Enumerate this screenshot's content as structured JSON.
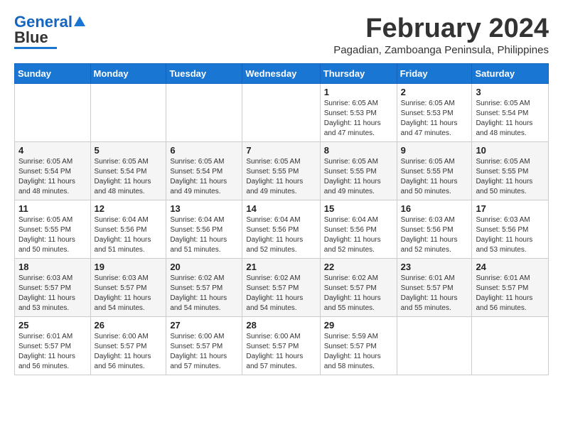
{
  "header": {
    "logo_general": "General",
    "logo_blue": "Blue",
    "month_title": "February 2024",
    "subtitle": "Pagadian, Zamboanga Peninsula, Philippines"
  },
  "columns": [
    "Sunday",
    "Monday",
    "Tuesday",
    "Wednesday",
    "Thursday",
    "Friday",
    "Saturday"
  ],
  "weeks": [
    [
      {
        "day": "",
        "info": ""
      },
      {
        "day": "",
        "info": ""
      },
      {
        "day": "",
        "info": ""
      },
      {
        "day": "",
        "info": ""
      },
      {
        "day": "1",
        "info": "Sunrise: 6:05 AM\nSunset: 5:53 PM\nDaylight: 11 hours\nand 47 minutes."
      },
      {
        "day": "2",
        "info": "Sunrise: 6:05 AM\nSunset: 5:53 PM\nDaylight: 11 hours\nand 47 minutes."
      },
      {
        "day": "3",
        "info": "Sunrise: 6:05 AM\nSunset: 5:54 PM\nDaylight: 11 hours\nand 48 minutes."
      }
    ],
    [
      {
        "day": "4",
        "info": "Sunrise: 6:05 AM\nSunset: 5:54 PM\nDaylight: 11 hours\nand 48 minutes."
      },
      {
        "day": "5",
        "info": "Sunrise: 6:05 AM\nSunset: 5:54 PM\nDaylight: 11 hours\nand 48 minutes."
      },
      {
        "day": "6",
        "info": "Sunrise: 6:05 AM\nSunset: 5:54 PM\nDaylight: 11 hours\nand 49 minutes."
      },
      {
        "day": "7",
        "info": "Sunrise: 6:05 AM\nSunset: 5:55 PM\nDaylight: 11 hours\nand 49 minutes."
      },
      {
        "day": "8",
        "info": "Sunrise: 6:05 AM\nSunset: 5:55 PM\nDaylight: 11 hours\nand 49 minutes."
      },
      {
        "day": "9",
        "info": "Sunrise: 6:05 AM\nSunset: 5:55 PM\nDaylight: 11 hours\nand 50 minutes."
      },
      {
        "day": "10",
        "info": "Sunrise: 6:05 AM\nSunset: 5:55 PM\nDaylight: 11 hours\nand 50 minutes."
      }
    ],
    [
      {
        "day": "11",
        "info": "Sunrise: 6:05 AM\nSunset: 5:55 PM\nDaylight: 11 hours\nand 50 minutes."
      },
      {
        "day": "12",
        "info": "Sunrise: 6:04 AM\nSunset: 5:56 PM\nDaylight: 11 hours\nand 51 minutes."
      },
      {
        "day": "13",
        "info": "Sunrise: 6:04 AM\nSunset: 5:56 PM\nDaylight: 11 hours\nand 51 minutes."
      },
      {
        "day": "14",
        "info": "Sunrise: 6:04 AM\nSunset: 5:56 PM\nDaylight: 11 hours\nand 52 minutes."
      },
      {
        "day": "15",
        "info": "Sunrise: 6:04 AM\nSunset: 5:56 PM\nDaylight: 11 hours\nand 52 minutes."
      },
      {
        "day": "16",
        "info": "Sunrise: 6:03 AM\nSunset: 5:56 PM\nDaylight: 11 hours\nand 52 minutes."
      },
      {
        "day": "17",
        "info": "Sunrise: 6:03 AM\nSunset: 5:56 PM\nDaylight: 11 hours\nand 53 minutes."
      }
    ],
    [
      {
        "day": "18",
        "info": "Sunrise: 6:03 AM\nSunset: 5:57 PM\nDaylight: 11 hours\nand 53 minutes."
      },
      {
        "day": "19",
        "info": "Sunrise: 6:03 AM\nSunset: 5:57 PM\nDaylight: 11 hours\nand 54 minutes."
      },
      {
        "day": "20",
        "info": "Sunrise: 6:02 AM\nSunset: 5:57 PM\nDaylight: 11 hours\nand 54 minutes."
      },
      {
        "day": "21",
        "info": "Sunrise: 6:02 AM\nSunset: 5:57 PM\nDaylight: 11 hours\nand 54 minutes."
      },
      {
        "day": "22",
        "info": "Sunrise: 6:02 AM\nSunset: 5:57 PM\nDaylight: 11 hours\nand 55 minutes."
      },
      {
        "day": "23",
        "info": "Sunrise: 6:01 AM\nSunset: 5:57 PM\nDaylight: 11 hours\nand 55 minutes."
      },
      {
        "day": "24",
        "info": "Sunrise: 6:01 AM\nSunset: 5:57 PM\nDaylight: 11 hours\nand 56 minutes."
      }
    ],
    [
      {
        "day": "25",
        "info": "Sunrise: 6:01 AM\nSunset: 5:57 PM\nDaylight: 11 hours\nand 56 minutes."
      },
      {
        "day": "26",
        "info": "Sunrise: 6:00 AM\nSunset: 5:57 PM\nDaylight: 11 hours\nand 56 minutes."
      },
      {
        "day": "27",
        "info": "Sunrise: 6:00 AM\nSunset: 5:57 PM\nDaylight: 11 hours\nand 57 minutes."
      },
      {
        "day": "28",
        "info": "Sunrise: 6:00 AM\nSunset: 5:57 PM\nDaylight: 11 hours\nand 57 minutes."
      },
      {
        "day": "29",
        "info": "Sunrise: 5:59 AM\nSunset: 5:57 PM\nDaylight: 11 hours\nand 58 minutes."
      },
      {
        "day": "",
        "info": ""
      },
      {
        "day": "",
        "info": ""
      }
    ]
  ]
}
